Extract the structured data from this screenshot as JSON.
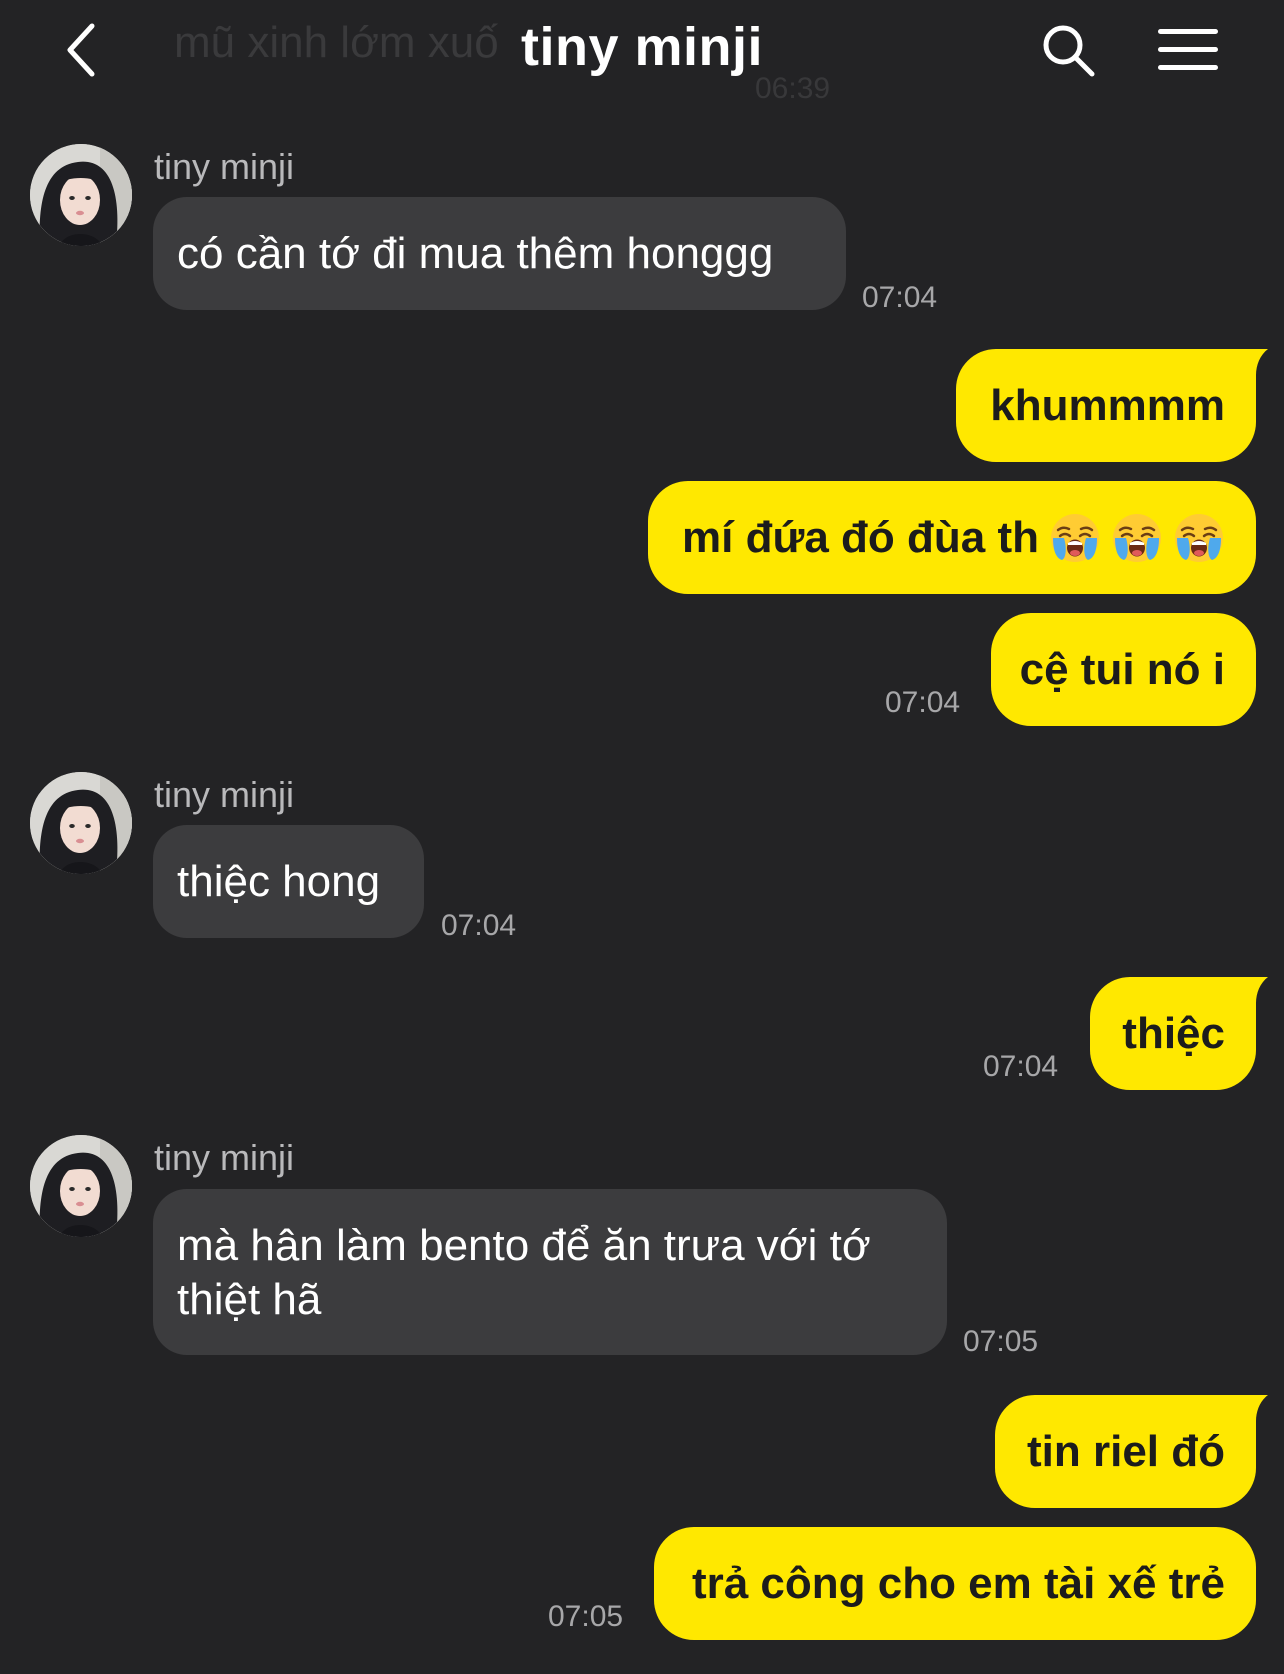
{
  "header": {
    "title": "tiny minji",
    "background_message": "mũ xinh lớm xuố",
    "background_time": "06:39"
  },
  "colors": {
    "background": "#232325",
    "incoming_bubble": "#3c3c3e",
    "outgoing_bubble": "#ffe800",
    "timestamp": "#a7a7a9"
  },
  "icons": {
    "back": "chevron-left-icon",
    "search": "search-icon",
    "menu": "hamburger-menu-icon",
    "emoji": "loudly-crying-face-emoji"
  },
  "messages": [
    {
      "type": "incoming",
      "sender": "tiny minji",
      "text": "có cần tớ đi mua thêm honggg",
      "time": "07:04"
    },
    {
      "type": "outgoing",
      "text": "khummmm"
    },
    {
      "type": "outgoing",
      "text": "mí đứa đó đùa th",
      "emoji_count": 3
    },
    {
      "type": "outgoing",
      "text": "cệ tui nó i",
      "time": "07:04"
    },
    {
      "type": "incoming",
      "sender": "tiny minji",
      "text": "thiệc hong",
      "time": "07:04"
    },
    {
      "type": "outgoing",
      "text": "thiệc",
      "time": "07:04"
    },
    {
      "type": "incoming",
      "sender": "tiny minji",
      "text": "mà hân làm bento để ăn trưa với tớ thiệt hã",
      "time": "07:05"
    },
    {
      "type": "outgoing",
      "text": "tin riel đó"
    },
    {
      "type": "outgoing",
      "text": "trả công cho em tài xế trẻ",
      "time": "07:05"
    }
  ]
}
